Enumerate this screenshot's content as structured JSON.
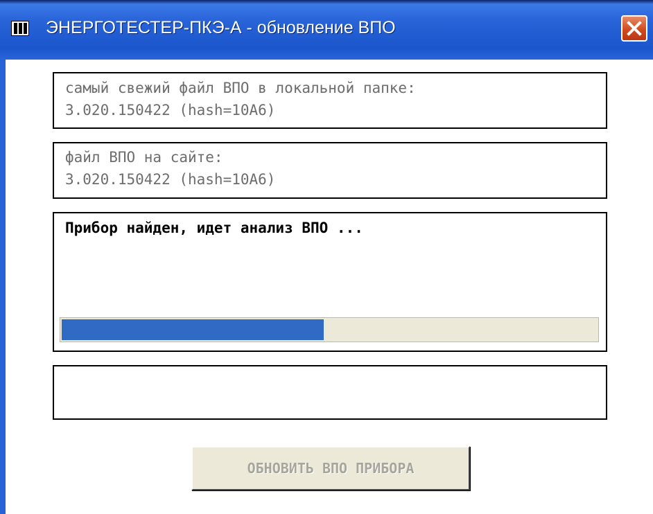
{
  "window": {
    "title": "ЭНЕРГОТЕСТЕР-ПКЭ-А - обновление ВПО"
  },
  "local_file": {
    "label": "самый свежий файл ВПО в локальной папке:",
    "version": "3.020.150422 (hash=10A6)"
  },
  "site_file": {
    "label": "файл ВПО на сайте:",
    "version": "3.020.150422 (hash=10A6)"
  },
  "status": {
    "message": "Прибор найден, идет анализ ВПО ...",
    "progress_fraction": 0.49
  },
  "log": {
    "text": ""
  },
  "actions": {
    "update_label": "ОБНОВИТЬ ВПО ПРИБОРА"
  },
  "colors": {
    "titlebar": "#2863d8",
    "progress_fill": "#316ac5",
    "progress_track": "#ece9d8",
    "close_button": "#d24b1c"
  }
}
